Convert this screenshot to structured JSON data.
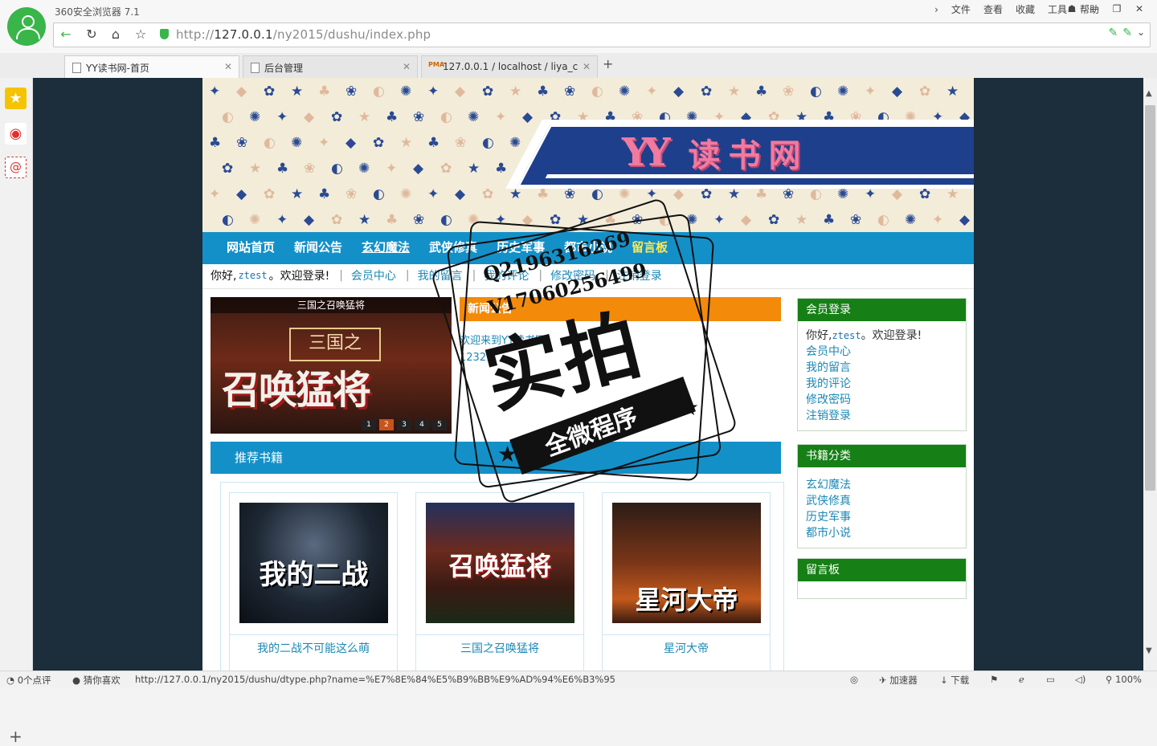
{
  "browser": {
    "app_title": "360安全浏览器 7.1",
    "menu": [
      "文件",
      "查看",
      "收藏",
      "工具",
      "帮助"
    ],
    "url_prefix": "http://",
    "url_host": "127.0.0.1",
    "url_path": "/ny2015/dushu/index.php",
    "tabs": [
      {
        "label": "YY读书网-首页",
        "active": true
      },
      {
        "label": "后台管理",
        "active": false
      },
      {
        "label": "127.0.0.1 / localhost / liya_c",
        "active": false
      }
    ],
    "pma_label": "PMA",
    "status": {
      "comments": "0个点评",
      "guess": "猜你喜欢",
      "link": "http://127.0.0.1/ny2015/dushu/dtype.php?name=%E7%8E%84%E5%B9%BB%E9%AD%94%E6%B3%95",
      "accelerator": "加速器",
      "download": "下载",
      "zoom": "100%"
    }
  },
  "site": {
    "logo_yy": "YY",
    "name": "读书网",
    "nav": [
      "网站首页",
      "新闻公告",
      "玄幻魔法",
      "武侠修真",
      "历史军事",
      "都市小说",
      "留言板"
    ],
    "welcome": {
      "greeting": "你好,",
      "user": "ztest",
      "suffix": "。欢迎登录!",
      "links": [
        "会员中心",
        "我的留言",
        "我的评论",
        "修改密码",
        "注销登录"
      ]
    },
    "slide": {
      "caption": "三国之召唤猛将",
      "sub": "三国之",
      "main": "召唤猛将",
      "dots": [
        "1",
        "2",
        "3",
        "4",
        "5"
      ],
      "active_dot": "2"
    },
    "news": {
      "heading": "新闻公告",
      "items": [
        "欢迎来到YY读书网",
        "12321"
      ]
    },
    "recommended": {
      "heading": "推荐书籍",
      "books": [
        {
          "title": "我的二战不可能这么萌",
          "cover_text": "我的二战"
        },
        {
          "title": "三国之召唤猛将",
          "cover_text": "召唤猛将"
        },
        {
          "title": "星河大帝",
          "cover_text": "星河大帝"
        }
      ]
    },
    "member_box": {
      "heading": "会员登录",
      "greeting": "你好,",
      "user": "ztest",
      "suffix": "。欢迎登录!",
      "links": [
        "会员中心",
        "我的留言",
        "我的评论",
        "修改密码",
        "注销登录"
      ]
    },
    "category_box": {
      "heading": "书籍分类",
      "links": [
        "玄幻魔法",
        "武侠修真",
        "历史军事",
        "都市小说"
      ]
    },
    "guestbook_box": {
      "heading": "留言板"
    }
  },
  "watermark": {
    "qq": "Q2196316269",
    "vx": "V17060256499",
    "big": "实拍",
    "ribbon": "全微程序"
  },
  "colors": {
    "nav": "#1490c8",
    "news_header": "#f38a0a",
    "side_header": "#168016",
    "link": "#1c88b5",
    "page_bg": "#1c2d3b"
  }
}
